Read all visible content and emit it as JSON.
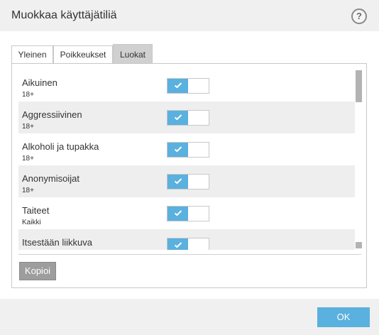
{
  "window": {
    "title": "Muokkaa käyttäjätiliä",
    "help_label": "?"
  },
  "tabs": [
    {
      "label": "Yleinen",
      "active": false
    },
    {
      "label": "Poikkeukset",
      "active": false
    },
    {
      "label": "Luokat",
      "active": true
    }
  ],
  "categories": [
    {
      "name": "Aikuinen",
      "age": "18+",
      "enabled": true
    },
    {
      "name": "Aggressiivinen",
      "age": "18+",
      "enabled": true
    },
    {
      "name": "Alkoholi ja tupakka",
      "age": "18+",
      "enabled": true
    },
    {
      "name": "Anonymisoijat",
      "age": "18+",
      "enabled": true
    },
    {
      "name": "Taiteet",
      "age": "Kaikki",
      "enabled": true
    },
    {
      "name": "Itsestään liikkuva",
      "age": "",
      "enabled": true
    }
  ],
  "buttons": {
    "copy_label": "Kopioi",
    "ok_label": "OK"
  },
  "colors": {
    "accent": "#5ab0de",
    "tab_active": "#d0d0d0",
    "row_alt": "#eeeeee",
    "copy_button": "#9d9d9d"
  }
}
